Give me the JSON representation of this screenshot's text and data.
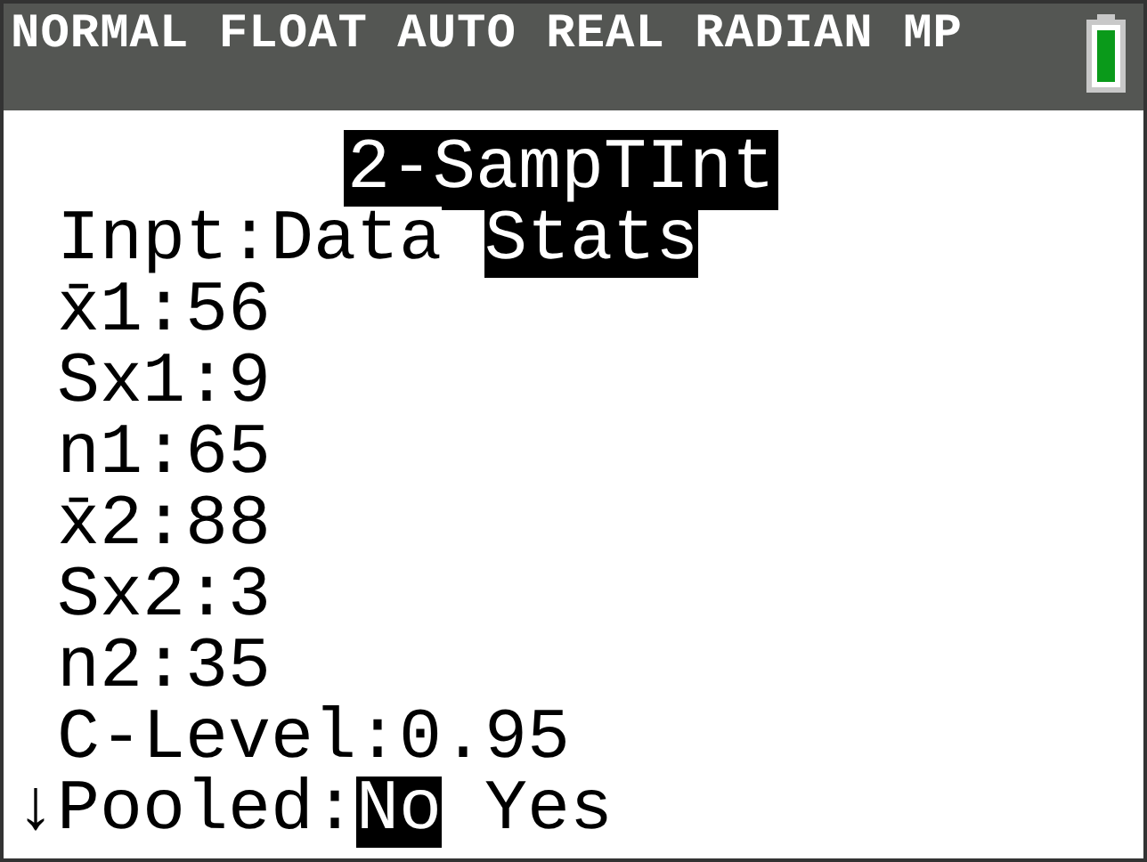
{
  "status_bar": {
    "text": "NORMAL FLOAT AUTO REAL RADIAN MP"
  },
  "title": "2-SampTInt",
  "rows": [
    {
      "kind": "choice",
      "label": "Inpt:",
      "options": [
        {
          "label": "Data",
          "selected": false
        },
        {
          "label": "Stats",
          "selected": true
        }
      ]
    },
    {
      "kind": "value",
      "label": "x̄1:",
      "value": "56"
    },
    {
      "kind": "value",
      "label": "Sx1:",
      "value": "9"
    },
    {
      "kind": "value",
      "label": "n1:",
      "value": "65"
    },
    {
      "kind": "value",
      "label": "x̄2:",
      "value": "88"
    },
    {
      "kind": "value",
      "label": "Sx2:",
      "value": "3"
    },
    {
      "kind": "value",
      "label": "n2:",
      "value": "35"
    },
    {
      "kind": "value",
      "label": "C-Level:",
      "value": "0.95"
    },
    {
      "kind": "choice",
      "scroll_arrow": "↓",
      "label": "Pooled:",
      "options": [
        {
          "label": "No",
          "selected": true
        },
        {
          "label": "Yes",
          "selected": false
        }
      ]
    }
  ]
}
